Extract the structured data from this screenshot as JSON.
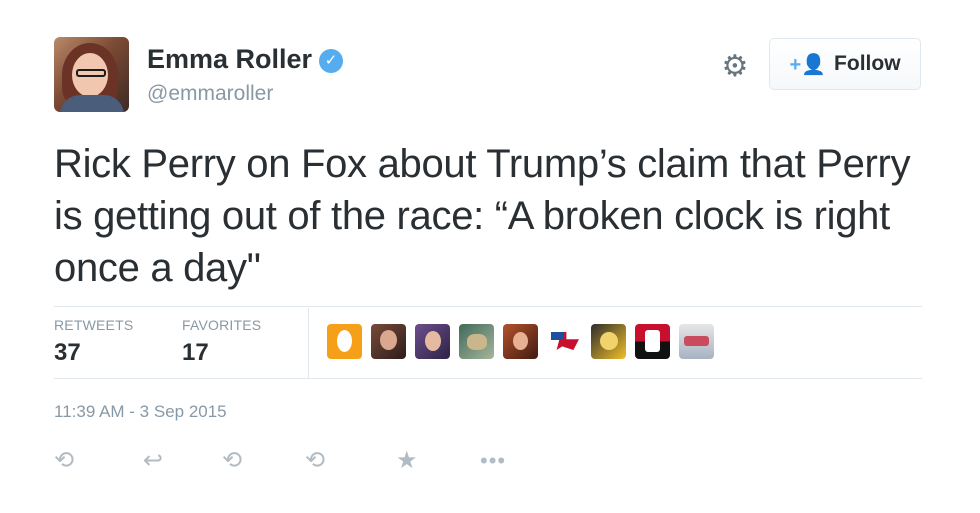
{
  "user": {
    "name": "Emma Roller",
    "handle": "@emmaroller"
  },
  "follow_button": {
    "label": "Follow"
  },
  "tweet": {
    "text": "Rick Perry on Fox about Trump’s claim that Perry is getting out of the race: “A broken clock is right once a day\""
  },
  "stats": {
    "retweets_label": "RETWEETS",
    "retweets_count": "37",
    "favorites_label": "FAVORITES",
    "favorites_count": "17"
  },
  "timestamp": "11:39 AM - 3 Sep 2015",
  "colors": {
    "accent": "#55acee",
    "text": "#292f33",
    "muted": "#8899a6",
    "action_icons": "#b1bbc3"
  },
  "icons": {
    "verified": "verified-badge-icon",
    "settings": "gear-icon",
    "follow": "add-user-icon",
    "retweet": "retweet-icon",
    "reply": "reply-icon",
    "favorite": "star-icon",
    "more": "more-dots-icon"
  }
}
